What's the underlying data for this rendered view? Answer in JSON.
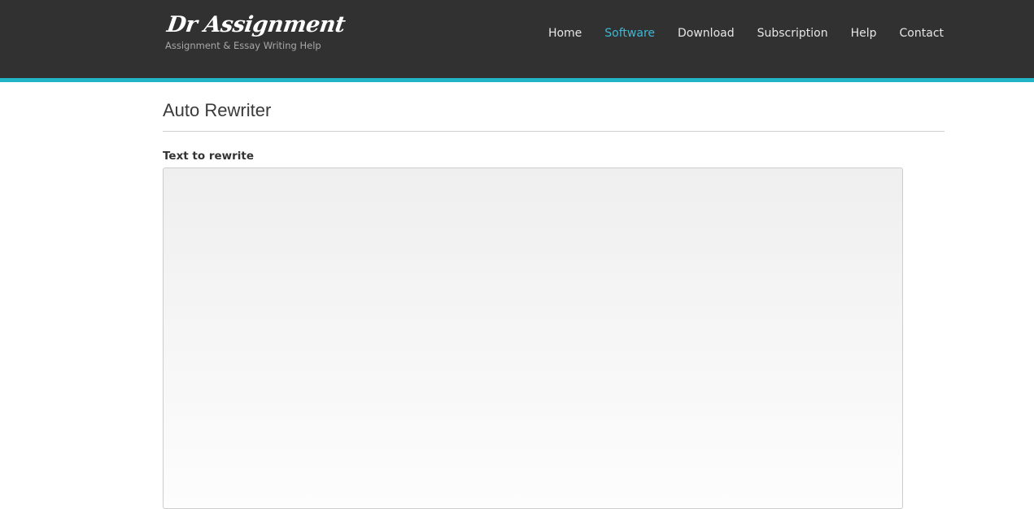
{
  "header": {
    "logo_title": "Dr Assignment",
    "logo_tagline": "Assignment & Essay Writing Help",
    "accent_color": "#1fb4c6",
    "background_color": "#313131",
    "active_nav_color": "#3fb8d3"
  },
  "nav": {
    "items": [
      {
        "label": "Home",
        "active": false
      },
      {
        "label": "Software",
        "active": true
      },
      {
        "label": "Download",
        "active": false
      },
      {
        "label": "Subscription",
        "active": false
      },
      {
        "label": "Help",
        "active": false
      },
      {
        "label": "Contact",
        "active": false
      }
    ]
  },
  "main": {
    "page_title": "Auto Rewriter",
    "field_label": "Text to rewrite",
    "textarea_value": ""
  }
}
